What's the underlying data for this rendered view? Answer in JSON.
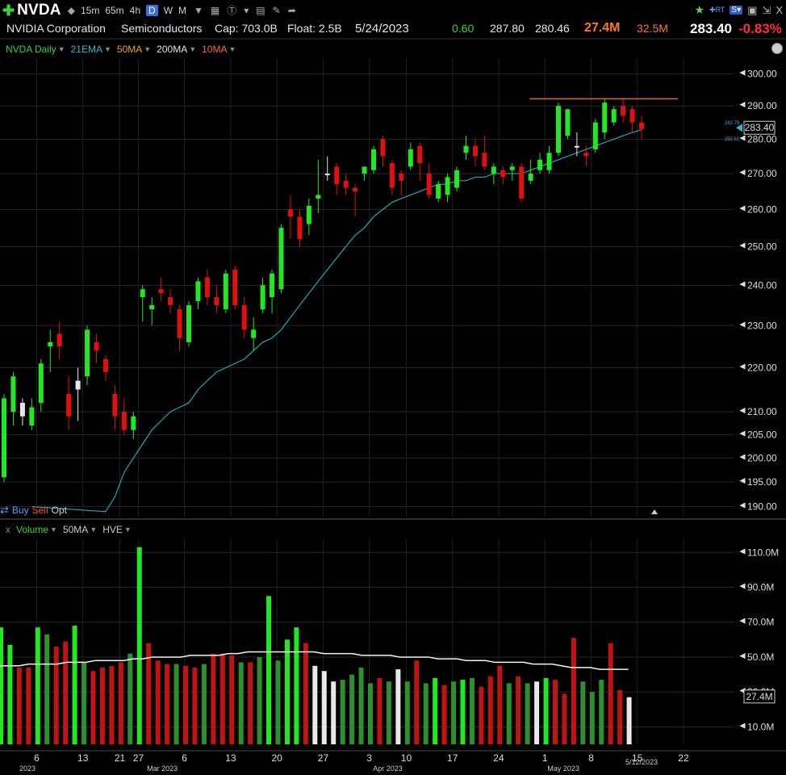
{
  "toolbar": {
    "ticker": "NVDA",
    "timeframes": [
      "15m",
      "65m",
      "4h",
      "D",
      "W",
      "M"
    ],
    "active_timeframe": "D"
  },
  "info": {
    "company": "NVIDIA Corporation",
    "sector": "Semiconductors",
    "cap": "Cap: 703.0B",
    "float": "Float: 2.5B",
    "date": "5/24/2023",
    "change_abs": "0.60",
    "high": "287.80",
    "low": "280.46",
    "volume": "27.4M",
    "avg_volume": "32.5M",
    "price": "283.40",
    "change_pct": "-0.83%"
  },
  "legend": {
    "daily": "NVDA Daily",
    "ema21": "21EMA",
    "ma50": "50MA",
    "ma200": "200MA",
    "ma10": "10MA"
  },
  "trade": {
    "buy": "Buy",
    "sell": "Sell",
    "opt": "Opt"
  },
  "volume_legend": {
    "close": "x",
    "volume": "Volume",
    "ma50": "50MA",
    "hve": "HVE"
  },
  "colors": {
    "up": "#22e822",
    "down": "#e01010",
    "neutral": "#e8e8e8",
    "ema": "#1fa9b0",
    "resistance": "#e06a1a",
    "vol_dark_green": "#2e8f2e",
    "vol_dark_red": "#a81414"
  },
  "chart_data": {
    "type": "candlestick",
    "price_axis": {
      "min": 188,
      "max": 305,
      "scale": "log",
      "ticks": [
        "190.00",
        "195.00",
        "200.00",
        "205.00",
        "210.00",
        "220.00",
        "230.00",
        "240.00",
        "250.00",
        "260.00",
        "270.00",
        "280.00",
        "290.00",
        "300.00"
      ],
      "last_price_label": "283.40",
      "ema_value_label": "282.79",
      "ma_value_label": "282.61"
    },
    "volume_axis": {
      "min": 0,
      "max": 118,
      "unit": "M",
      "ticks": [
        "10.0M",
        "30.0M",
        "50.0M",
        "70.0M",
        "90.0M",
        "110.0M"
      ],
      "last_volume_label": "27.4M"
    },
    "x_axis": {
      "labels": [
        {
          "i": 1,
          "t": "6"
        },
        {
          "i": 6,
          "t": "13"
        },
        {
          "i": 10,
          "t": "21"
        },
        {
          "i": 12,
          "t": "27"
        },
        {
          "i": 17,
          "t": "6"
        },
        {
          "i": 22,
          "t": "13"
        },
        {
          "i": 27,
          "t": "20"
        },
        {
          "i": 32,
          "t": "27"
        },
        {
          "i": 37,
          "t": "3"
        },
        {
          "i": 41,
          "t": "10"
        },
        {
          "i": 46,
          "t": "17"
        },
        {
          "i": 51,
          "t": "24"
        },
        {
          "i": 56,
          "t": "1"
        },
        {
          "i": 61,
          "t": "8"
        },
        {
          "i": 66,
          "t": "15"
        },
        {
          "i": 71,
          "t": "22"
        }
      ],
      "months": [
        {
          "i": 0,
          "t": "2023"
        },
        {
          "i": 14.6,
          "t": "Mar 2023"
        },
        {
          "i": 39,
          "t": "Apr 2023"
        },
        {
          "i": 58,
          "t": "May 2023"
        }
      ],
      "date_marker": "5/12/2023"
    },
    "resistance_line": {
      "price": 292.2,
      "from": 56,
      "to": 70
    },
    "candles": [
      {
        "o": 196,
        "h": 214,
        "l": 195,
        "c": 213
      },
      {
        "o": 210,
        "h": 219,
        "l": 207,
        "c": 218
      },
      {
        "o": 209,
        "h": 213,
        "l": 207,
        "c": 212
      },
      {
        "o": 207,
        "h": 213,
        "l": 206,
        "c": 211
      },
      {
        "o": 212,
        "h": 222,
        "l": 210,
        "c": 221
      },
      {
        "o": 225,
        "h": 229,
        "l": 219,
        "c": 226
      },
      {
        "o": 228,
        "h": 231,
        "l": 222,
        "c": 225
      },
      {
        "o": 214,
        "h": 218,
        "l": 206,
        "c": 209
      },
      {
        "o": 215,
        "h": 220,
        "l": 208,
        "c": 217
      },
      {
        "o": 218,
        "h": 230,
        "l": 216,
        "c": 229
      },
      {
        "o": 226,
        "h": 228,
        "l": 221,
        "c": 224
      },
      {
        "o": 222,
        "h": 223,
        "l": 217,
        "c": 219
      },
      {
        "o": 214,
        "h": 216,
        "l": 206,
        "c": 209
      },
      {
        "o": 210,
        "h": 213,
        "l": 205,
        "c": 206
      },
      {
        "o": 206,
        "h": 210,
        "l": 204,
        "c": 209
      },
      {
        "o": 237,
        "h": 240,
        "l": 231,
        "c": 239
      },
      {
        "o": 234,
        "h": 237,
        "l": 230,
        "c": 235
      },
      {
        "o": 239,
        "h": 242,
        "l": 236,
        "c": 238
      },
      {
        "o": 237,
        "h": 239,
        "l": 233,
        "c": 235
      },
      {
        "o": 234,
        "h": 235,
        "l": 224,
        "c": 227
      },
      {
        "o": 226,
        "h": 236,
        "l": 225,
        "c": 235
      },
      {
        "o": 236,
        "h": 242,
        "l": 234,
        "c": 241
      },
      {
        "o": 242,
        "h": 244,
        "l": 235,
        "c": 237
      },
      {
        "o": 237,
        "h": 240,
        "l": 233,
        "c": 235
      },
      {
        "o": 234,
        "h": 244,
        "l": 233,
        "c": 243
      },
      {
        "o": 244,
        "h": 245,
        "l": 234,
        "c": 235
      },
      {
        "o": 235,
        "h": 237,
        "l": 227,
        "c": 229
      },
      {
        "o": 227,
        "h": 232,
        "l": 224,
        "c": 229
      },
      {
        "o": 234,
        "h": 242,
        "l": 233,
        "c": 240
      },
      {
        "o": 237,
        "h": 244,
        "l": 233,
        "c": 243
      },
      {
        "o": 239,
        "h": 256,
        "l": 238,
        "c": 255
      },
      {
        "o": 260,
        "h": 264,
        "l": 252,
        "c": 258
      },
      {
        "o": 258,
        "h": 260,
        "l": 250,
        "c": 252
      },
      {
        "o": 256,
        "h": 263,
        "l": 253,
        "c": 261
      },
      {
        "o": 263,
        "h": 274,
        "l": 259,
        "c": 264
      },
      {
        "o": 270,
        "h": 275,
        "l": 268,
        "c": 270
      },
      {
        "o": 272,
        "h": 273,
        "l": 264,
        "c": 267
      },
      {
        "o": 268,
        "h": 270,
        "l": 264,
        "c": 266
      },
      {
        "o": 266,
        "h": 267,
        "l": 258,
        "c": 265
      },
      {
        "o": 270,
        "h": 272,
        "l": 268,
        "c": 272
      },
      {
        "o": 271,
        "h": 278,
        "l": 270,
        "c": 277
      },
      {
        "o": 280,
        "h": 281,
        "l": 272,
        "c": 275
      },
      {
        "o": 273,
        "h": 274,
        "l": 264,
        "c": 266
      },
      {
        "o": 270,
        "h": 271,
        "l": 264,
        "c": 268
      },
      {
        "o": 272,
        "h": 279,
        "l": 271,
        "c": 277
      },
      {
        "o": 278,
        "h": 279,
        "l": 268,
        "c": 273
      },
      {
        "o": 270,
        "h": 273,
        "l": 263,
        "c": 264
      },
      {
        "o": 263,
        "h": 268,
        "l": 262,
        "c": 267
      },
      {
        "o": 264,
        "h": 270,
        "l": 262,
        "c": 269
      },
      {
        "o": 266,
        "h": 272,
        "l": 265,
        "c": 271
      },
      {
        "o": 276,
        "h": 281,
        "l": 274,
        "c": 278
      },
      {
        "o": 278,
        "h": 280,
        "l": 272,
        "c": 275
      },
      {
        "o": 276,
        "h": 281,
        "l": 271,
        "c": 272
      },
      {
        "o": 270,
        "h": 273,
        "l": 267,
        "c": 272
      },
      {
        "o": 271,
        "h": 272,
        "l": 267,
        "c": 269
      },
      {
        "o": 271,
        "h": 273,
        "l": 268,
        "c": 272
      },
      {
        "o": 272,
        "h": 273,
        "l": 262,
        "c": 263
      },
      {
        "o": 268,
        "h": 274,
        "l": 267,
        "c": 270
      },
      {
        "o": 271,
        "h": 276,
        "l": 270,
        "c": 274
      },
      {
        "o": 271,
        "h": 278,
        "l": 270,
        "c": 276
      },
      {
        "o": 276,
        "h": 291,
        "l": 275,
        "c": 290
      },
      {
        "o": 281,
        "h": 289,
        "l": 280,
        "c": 289
      },
      {
        "o": 278,
        "h": 282,
        "l": 275,
        "c": 278
      },
      {
        "o": 276,
        "h": 278,
        "l": 272,
        "c": 275
      },
      {
        "o": 277,
        "h": 286,
        "l": 276,
        "c": 285
      },
      {
        "o": 282,
        "h": 292,
        "l": 280,
        "c": 291
      },
      {
        "o": 285,
        "h": 290,
        "l": 284,
        "c": 289
      },
      {
        "o": 290,
        "h": 292,
        "l": 285,
        "c": 287
      },
      {
        "o": 289,
        "h": 290,
        "l": 282,
        "c": 285
      },
      {
        "o": 285,
        "h": 287,
        "l": 280,
        "c": 283
      }
    ],
    "volume": [
      67,
      57,
      44,
      44,
      67,
      63,
      56,
      59,
      68,
      47,
      42,
      44,
      45,
      47,
      52,
      113,
      58,
      48,
      46,
      46,
      45,
      44,
      46,
      52,
      52,
      51,
      47,
      47,
      50,
      85,
      48,
      60,
      67,
      58,
      45,
      42,
      36,
      37,
      40,
      44,
      35,
      38,
      36,
      43,
      36,
      48,
      35,
      38,
      34,
      36,
      37,
      38,
      33,
      39,
      45,
      35,
      39,
      35,
      36,
      38,
      37,
      29,
      61,
      36,
      30,
      37,
      58,
      31,
      27
    ],
    "volume_colors": [
      "up",
      "up",
      "down",
      "down",
      "up",
      "dgreen",
      "down",
      "down",
      "up",
      "dgreen",
      "down",
      "down",
      "down",
      "down",
      "dgreen",
      "up",
      "down",
      "down",
      "down",
      "dgreen",
      "down",
      "down",
      "dgreen",
      "down",
      "down",
      "down",
      "dgreen",
      "down",
      "dgreen",
      "up",
      "dgreen",
      "up",
      "up",
      "down",
      "neutral",
      "neutral",
      "neutral",
      "dgreen",
      "dgreen",
      "dgreen",
      "dgreen",
      "down",
      "dgreen",
      "neutral",
      "dgreen",
      "down",
      "dgreen",
      "up",
      "down",
      "dgreen",
      "up",
      "dgreen",
      "down",
      "down",
      "down",
      "dgreen",
      "down",
      "dgreen",
      "neutral",
      "up",
      "down",
      "down",
      "down",
      "dgreen",
      "dgreen",
      "dgreen",
      "down",
      "down",
      "neutral"
    ],
    "ema21": [
      189,
      192,
      197,
      200,
      203,
      206,
      208,
      210,
      211,
      212,
      215,
      217,
      219,
      220,
      221,
      222,
      224,
      226,
      227,
      229,
      232,
      235,
      238,
      241,
      244,
      247,
      250,
      253,
      255,
      258,
      260,
      262,
      263,
      264,
      265,
      266,
      267,
      267,
      268,
      268,
      269,
      269,
      270,
      270,
      270,
      270,
      271,
      272,
      273,
      274,
      275,
      276,
      277,
      278,
      279,
      280,
      281,
      282,
      282.79
    ],
    "ema21_start": 11,
    "vol_ma50": [
      45,
      45,
      45,
      46,
      46,
      46,
      46,
      47,
      47,
      47,
      48,
      48,
      48,
      48,
      49,
      49,
      50,
      50,
      50,
      50,
      51,
      51,
      51,
      51,
      52,
      52,
      53,
      53,
      53,
      53,
      53,
      53,
      53,
      53,
      52,
      52,
      52,
      52,
      51,
      51,
      51,
      51,
      50,
      50,
      50,
      50,
      49,
      49,
      49,
      48,
      48,
      48,
      47,
      47,
      47,
      47,
      46,
      46,
      46,
      45,
      44,
      44,
      44,
      43,
      43,
      43,
      43
    ],
    "vol_ma50_start": 0
  }
}
